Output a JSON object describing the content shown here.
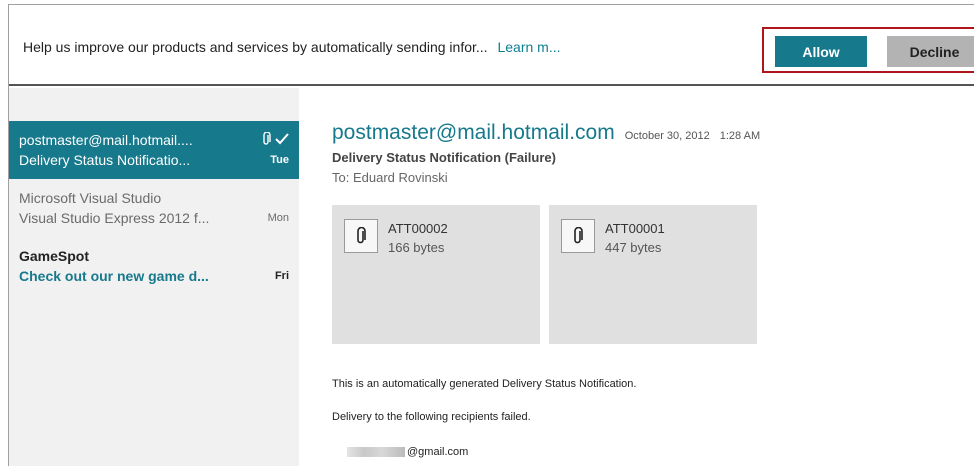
{
  "notification": {
    "text": "Help us improve our products and services by automatically sending infor...",
    "link": "Learn m...",
    "allow_label": "Allow",
    "decline_label": "Decline"
  },
  "messages": [
    {
      "from": "postmaster@mail.hotmail....",
      "subject": "Delivery Status Notificatio...",
      "day": "Tue",
      "has_attachment": true,
      "checked": true,
      "state": "selected"
    },
    {
      "from": "Microsoft Visual Studio",
      "subject": "Visual Studio Express 2012 f...",
      "day": "Mon",
      "state": "read"
    },
    {
      "from": "GameSpot",
      "subject": "Check out our new game d...",
      "day": "Fri",
      "state": "unread"
    }
  ],
  "reading": {
    "sender": "postmaster@mail.hotmail.com",
    "date": "October 30, 2012",
    "time": "1:28 AM",
    "subject": "Delivery Status Notification (Failure)",
    "to": "To: Eduard Rovinski",
    "attachments": [
      {
        "name": "ATT00002",
        "size": "166 bytes"
      },
      {
        "name": "ATT00001",
        "size": "447 bytes"
      }
    ],
    "body": [
      "This is an automatically generated Delivery Status Notification.",
      "Delivery to the following recipients failed."
    ],
    "recipient_suffix": "@gmail.com"
  },
  "colors": {
    "accent": "#16798c",
    "decline_bg": "#b3b3b3",
    "highlight_border": "#b0141c",
    "list_bg": "#f1f1f1",
    "attachment_bg": "#e0e0e0"
  }
}
